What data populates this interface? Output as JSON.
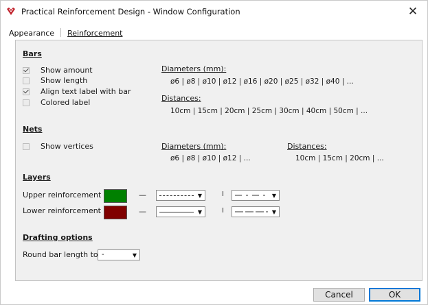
{
  "window": {
    "title": "Practical Reinforcement Design - Window Configuration",
    "close_glyph": "✕",
    "icon": "app-logo-icon",
    "accent_color": "#c0202a"
  },
  "tabs": [
    {
      "label": "Appearance",
      "active": false
    },
    {
      "label": "Reinforcement",
      "active": true
    }
  ],
  "bars": {
    "heading": "Bars",
    "options": [
      {
        "label": "Show amount",
        "checked": true
      },
      {
        "label": "Show length",
        "checked": false
      },
      {
        "label": "Align text label with bar",
        "checked": true
      },
      {
        "label": "Colored label",
        "checked": false
      }
    ],
    "diameters_label": "Diameters (mm):",
    "diameters_value": "ø6 | ø8 | ø10 | ø12 | ø16 | ø20 | ø25 | ø32 | ø40 | ...",
    "distances_label": "Distances:",
    "distances_value": "10cm | 15cm | 20cm | 25cm | 30cm | 40cm | 50cm | ..."
  },
  "nets": {
    "heading": "Nets",
    "options": [
      {
        "label": "Show vertices",
        "checked": false
      }
    ],
    "diameters_label": "Diameters (mm):",
    "diameters_value": "ø6 | ø8 | ø10 | ø12 | ...",
    "distances_label": "Distances:",
    "distances_value": "10cm | 15cm | 20cm | ..."
  },
  "layers": {
    "heading": "Layers",
    "rows": [
      {
        "label": "Upper reinforcement",
        "color": "#008000",
        "linetype": "dashed",
        "linetype2": "dash-dot"
      },
      {
        "label": "Lower reinforcement",
        "color": "#800000",
        "linetype": "solid",
        "linetype2": "long-dash"
      }
    ],
    "line_glyph": "—",
    "sep_glyph": "I"
  },
  "drafting": {
    "heading": "Drafting options",
    "round_label": "Round bar length to",
    "round_value": "-"
  },
  "buttons": {
    "cancel": "Cancel",
    "ok": "OK"
  },
  "dropdown_arrow": "▼"
}
